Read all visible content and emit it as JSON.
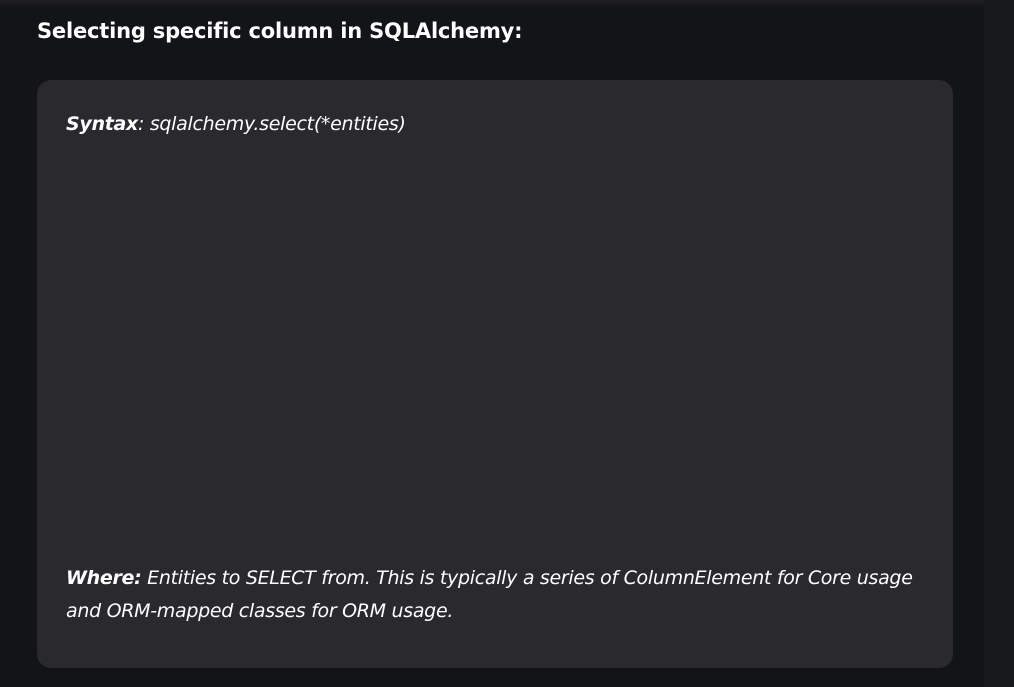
{
  "heading": "Selecting specific column in SQLAlchemy:",
  "syntax": {
    "label": "Syntax",
    "separator": ": ",
    "code": "sqlalchemy.select(*entities)"
  },
  "where": {
    "label": "Where:",
    "text": " Entities to SELECT from. This is typically a series of ColumnElement for Core usage and ORM-mapped classes for ORM usage."
  },
  "colors": {
    "background": "#131417",
    "card": "#2a2a2e",
    "text": "#ffffff"
  }
}
